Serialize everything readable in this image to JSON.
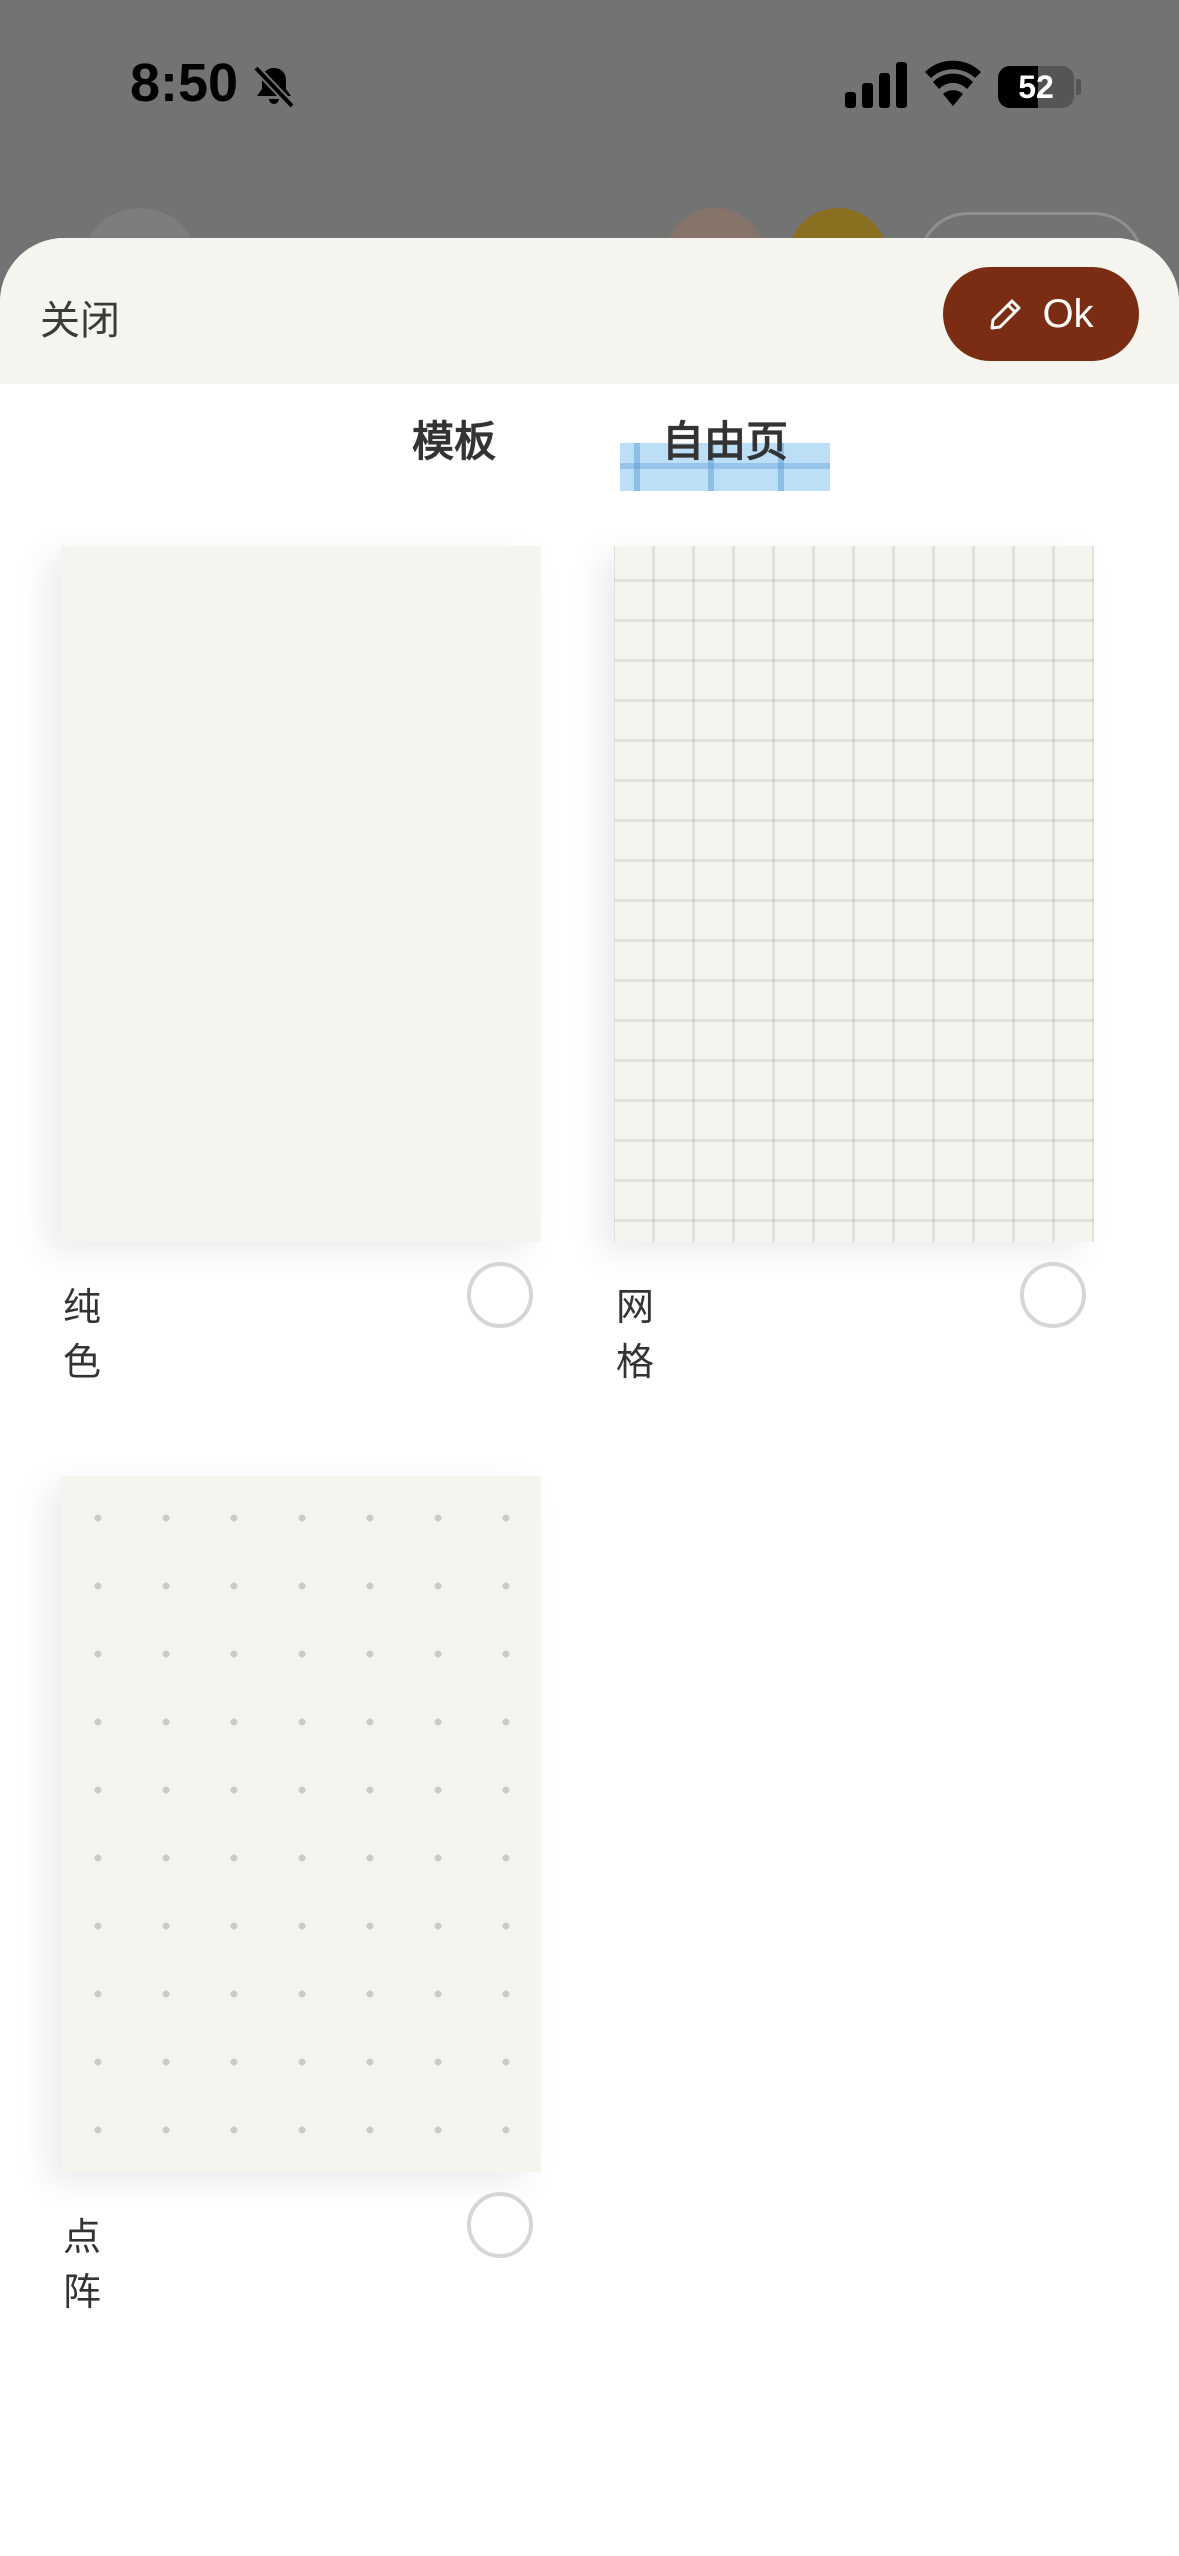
{
  "status_bar": {
    "time": "8:50",
    "battery_level": "52",
    "icons": [
      "bell-slash-icon",
      "cellular-signal-icon",
      "wifi-icon",
      "battery-icon"
    ]
  },
  "sheet": {
    "close_label": "关闭",
    "ok_label": "Ok",
    "ok_icon": "pencil-icon",
    "accent_color": "#7a2d12",
    "header_bg": "#f6f4ef"
  },
  "tabs": [
    {
      "label": "模板"
    },
    {
      "label": "自由页"
    }
  ],
  "templates": [
    {
      "label": "纯色",
      "pattern": "solid",
      "selected": false
    },
    {
      "label": "网格",
      "pattern": "grid",
      "selected": false
    },
    {
      "label": "点阵",
      "pattern": "dots",
      "selected": false
    }
  ]
}
